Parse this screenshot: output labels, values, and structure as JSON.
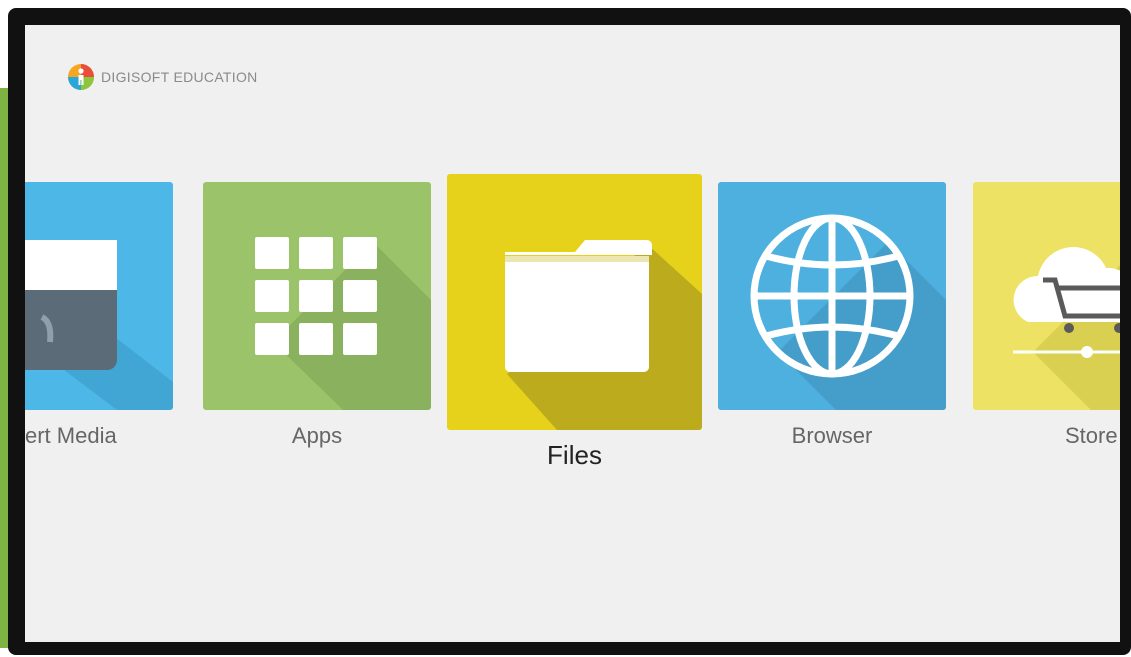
{
  "brand": {
    "name": "DIGISOFT EDUCATION",
    "logo_icon": "digisoft-logo-icon"
  },
  "launcher": {
    "focused": "Files",
    "items": [
      {
        "label": "ert Media",
        "icon": "smart-media-icon",
        "color": "#4db8e8"
      },
      {
        "label": "Apps",
        "icon": "apps-grid-icon",
        "color": "#9bc46a"
      },
      {
        "label": "Files",
        "icon": "folder-icon",
        "color": "#e6d21a"
      },
      {
        "label": "Browser",
        "icon": "globe-icon",
        "color": "#4db0df"
      },
      {
        "label": "Store",
        "icon": "cloud-cart-icon",
        "color": "#ede263"
      }
    ]
  }
}
